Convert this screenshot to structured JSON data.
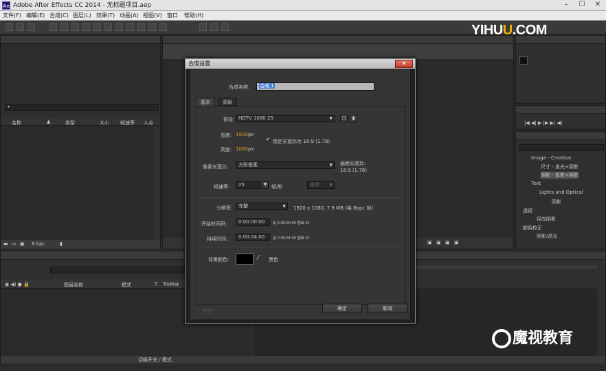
{
  "window": {
    "title": "Adobe After Effects CC 2014 - 无标题项目.aep",
    "logo": "Ae"
  },
  "menu": [
    "文件(F)",
    "编辑(E)",
    "合成(C)",
    "图层(L)",
    "效果(T)",
    "动画(A)",
    "视图(V)",
    "窗口",
    "帮助(H)"
  ],
  "watermark_top": {
    "part1": "YIHU",
    "part2": "U",
    "part3": ".COM"
  },
  "watermark_bottom": "魔视教育",
  "project_panel": {
    "columns": [
      "名称",
      "类型",
      "大小",
      "帧速率",
      "入点"
    ],
    "footer_bpc": "8 bpc"
  },
  "timeline": {
    "columns": [
      "图层名称",
      "模式",
      "T",
      "TrkMat"
    ],
    "footer": "切换开关 / 模式"
  },
  "effects_panel": {
    "items": [
      "Image - Creative",
      "尺寸 - 发光+阴影",
      "阴影 - 投影+阴影",
      "Text",
      "Lights and Optical",
      "阴影",
      "透视",
      "径向阴影",
      "颜色校正",
      "阴影/高光"
    ]
  },
  "dialog": {
    "title": "合成设置",
    "comp_name_label": "合成名称:",
    "comp_name_value": "合成 1",
    "tabs": [
      "基本",
      "高级"
    ],
    "preset_label": "预设:",
    "preset_value": "HDTV 1080 25",
    "width_label": "宽度:",
    "width_value": "1920",
    "width_unit": "px",
    "height_label": "高度:",
    "height_value": "1080",
    "height_unit": "px",
    "lock_label": "锁定长宽比为 16:9 (1.78)",
    "par_label": "像素长宽比:",
    "par_value": "方形像素",
    "frame_aspect_label": "画面长宽比:",
    "frame_aspect_value": "16:9 (1.78)",
    "fps_label": "帧速率:",
    "fps_value": "25",
    "fps_unit": "帧/秒",
    "drop_frame": "丢帧",
    "resolution_label": "分辨率:",
    "resolution_value": "完整",
    "resolution_info": "1920 x 1080, 7.9 MB (每 8bpc 帧)",
    "start_tc_label": "开始时间码:",
    "start_tc_value": "0:00:00:00",
    "start_tc_info": "是 0:00:00:00  基础 25",
    "duration_label": "持续时间:",
    "duration_value": "0:00:04:00",
    "duration_info": "是 0:00:04:00  基础 25",
    "bg_label": "背景颜色:",
    "bg_name": "黑色",
    "bg_color": "#000000",
    "preview": "预览",
    "ok": "确定",
    "cancel": "取消"
  }
}
